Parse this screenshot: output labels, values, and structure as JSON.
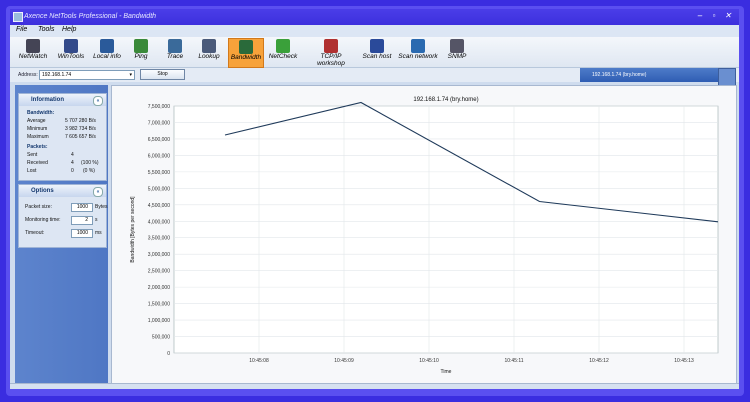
{
  "window": {
    "title": "Axence NetTools Professional - Bandwidth"
  },
  "menu": {
    "file": "File",
    "tools": "Tools",
    "help": "Help"
  },
  "toolbar": {
    "items": [
      {
        "label": "NetWatch",
        "icon": "netwatch-icon"
      },
      {
        "label": "WinTools",
        "icon": "wintools-icon"
      },
      {
        "label": "Local info",
        "icon": "local-info-icon"
      },
      {
        "label": "Ping",
        "icon": "ping-icon"
      },
      {
        "label": "Trace",
        "icon": "trace-icon"
      },
      {
        "label": "Lookup",
        "icon": "lookup-icon"
      },
      {
        "label": "Bandwidth",
        "icon": "bandwidth-icon",
        "active": true
      },
      {
        "label": "NetCheck",
        "icon": "netcheck-icon"
      },
      {
        "label": "TCP/IP workshop",
        "icon": "tcpip-icon"
      },
      {
        "label": "Scan host",
        "icon": "scan-host-icon"
      },
      {
        "label": "Scan network",
        "icon": "scan-network-icon"
      },
      {
        "label": "SNMP",
        "icon": "snmp-icon"
      }
    ]
  },
  "address": {
    "label": "Address:",
    "value": "192.168.1.74",
    "stop": "Stop",
    "host": "192.168.1.74 (bry.home)"
  },
  "info": {
    "title": "Information",
    "bandwidth_head": "Bandwidth:",
    "average_label": "Average",
    "average_value": "5 707 280 B/s",
    "minimum_label": "Minimum",
    "minimum_value": "3 982 734 B/s",
    "maximum_label": "Maximum",
    "maximum_value": "7 605 657 B/s",
    "packets_head": "Packets:",
    "sent_label": "Sent",
    "sent_value": "4",
    "received_label": "Received",
    "received_value": "4",
    "received_pct": "(100 %)",
    "lost_label": "Lost",
    "lost_value": "0",
    "lost_pct": "(0 %)"
  },
  "options": {
    "title": "Options",
    "packet_size_label": "Packet size:",
    "packet_size_value": "1000",
    "packet_size_unit": "Bytes",
    "monitoring_label": "Monitoring time:",
    "monitoring_value": "2",
    "monitoring_unit": "s",
    "timeout_label": "Timeout:",
    "timeout_value": "1000",
    "timeout_unit": "ms"
  },
  "colors": {
    "line": "#1f3a5a",
    "active_tab": "#f7a23a"
  },
  "chart_data": {
    "type": "line",
    "title": "192.168.1.74 (bry.home)",
    "xlabel": "Time",
    "ylabel": "Bandwidth [Bytes per second]",
    "x": [
      "10:45:08",
      "10:45:09",
      "10:45:10",
      "10:45:11",
      "10:45:12",
      "10:45:13"
    ],
    "ylim": [
      0,
      7500000
    ],
    "yticks": [
      "7,500,000",
      "7,000,000",
      "6,500,000",
      "6,000,000",
      "5,500,000",
      "5,000,000",
      "4,500,000",
      "4,000,000",
      "3,500,000",
      "3,000,000",
      "2,500,000",
      "2,000,000",
      "1,500,000",
      "1,000,000",
      "500,000",
      "0"
    ],
    "series": [
      {
        "points": [
          {
            "t": 7.6,
            "v": 6620000
          },
          {
            "t": 9.2,
            "v": 7605657
          },
          {
            "t": 11.3,
            "v": 4600000
          },
          {
            "t": 13.4,
            "v": 3982734
          }
        ]
      }
    ],
    "grid": true
  }
}
